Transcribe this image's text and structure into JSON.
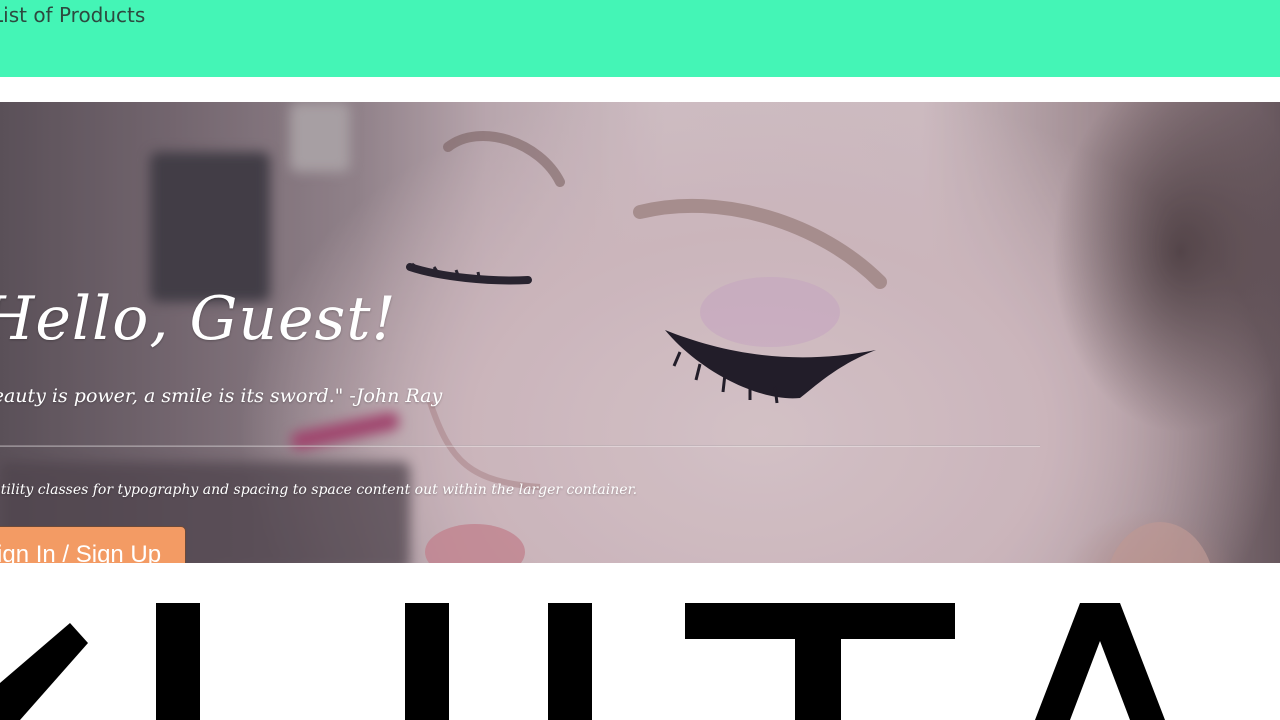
{
  "nav": {
    "link_label": "List of Products",
    "background": "#44f5b6"
  },
  "hero": {
    "title": "Hello, Guest!",
    "quote": "\"Beauty is power, a smile is its sword.\" -John Ray",
    "lead": "It uses utility classes for typography and spacing to space content out within the larger container.",
    "button_label": "Sign In / Sign Up",
    "button_color": "#f39b64"
  },
  "brand_logo": {
    "text": "ULTA",
    "color": "#000000"
  }
}
